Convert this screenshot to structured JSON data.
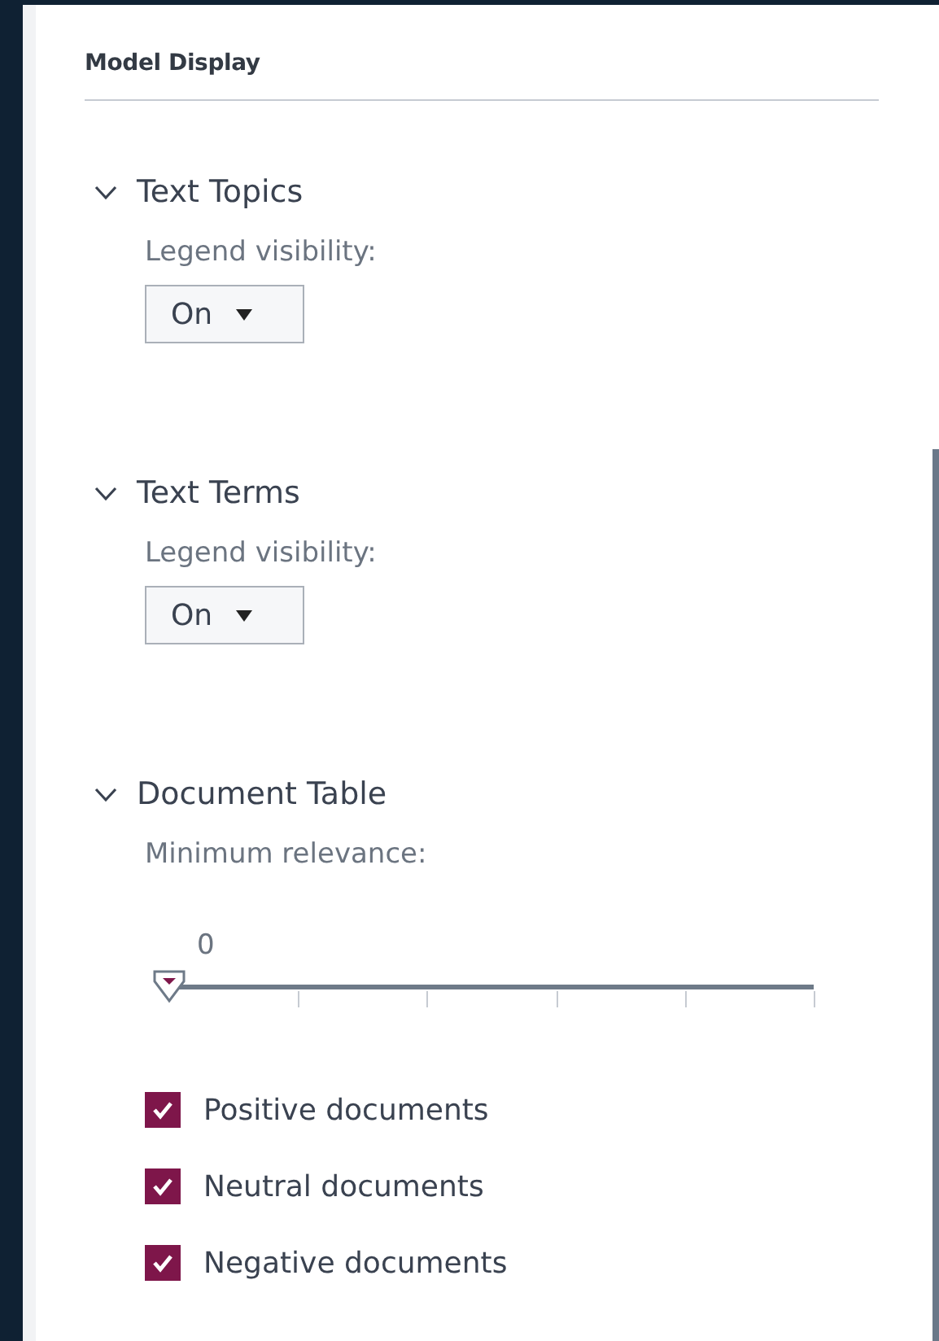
{
  "panel": {
    "title": "Model Display"
  },
  "sections": [
    {
      "kind": "dropdown",
      "title": "Text Topics",
      "expanded": true,
      "label": "Legend visibility:",
      "value": "On"
    },
    {
      "kind": "dropdown",
      "title": "Text Terms",
      "expanded": true,
      "label": "Legend visibility:",
      "value": "On"
    },
    {
      "kind": "slider",
      "title": "Document Table",
      "expanded": true,
      "label": "Minimum relevance:",
      "reading": "0",
      "level": 0,
      "checkboxes": [
        {
          "label": "Positive documents",
          "checked": true
        },
        {
          "label": "Neutral documents",
          "checked": true
        },
        {
          "label": "Negative documents",
          "checked": true
        }
      ]
    }
  ]
}
